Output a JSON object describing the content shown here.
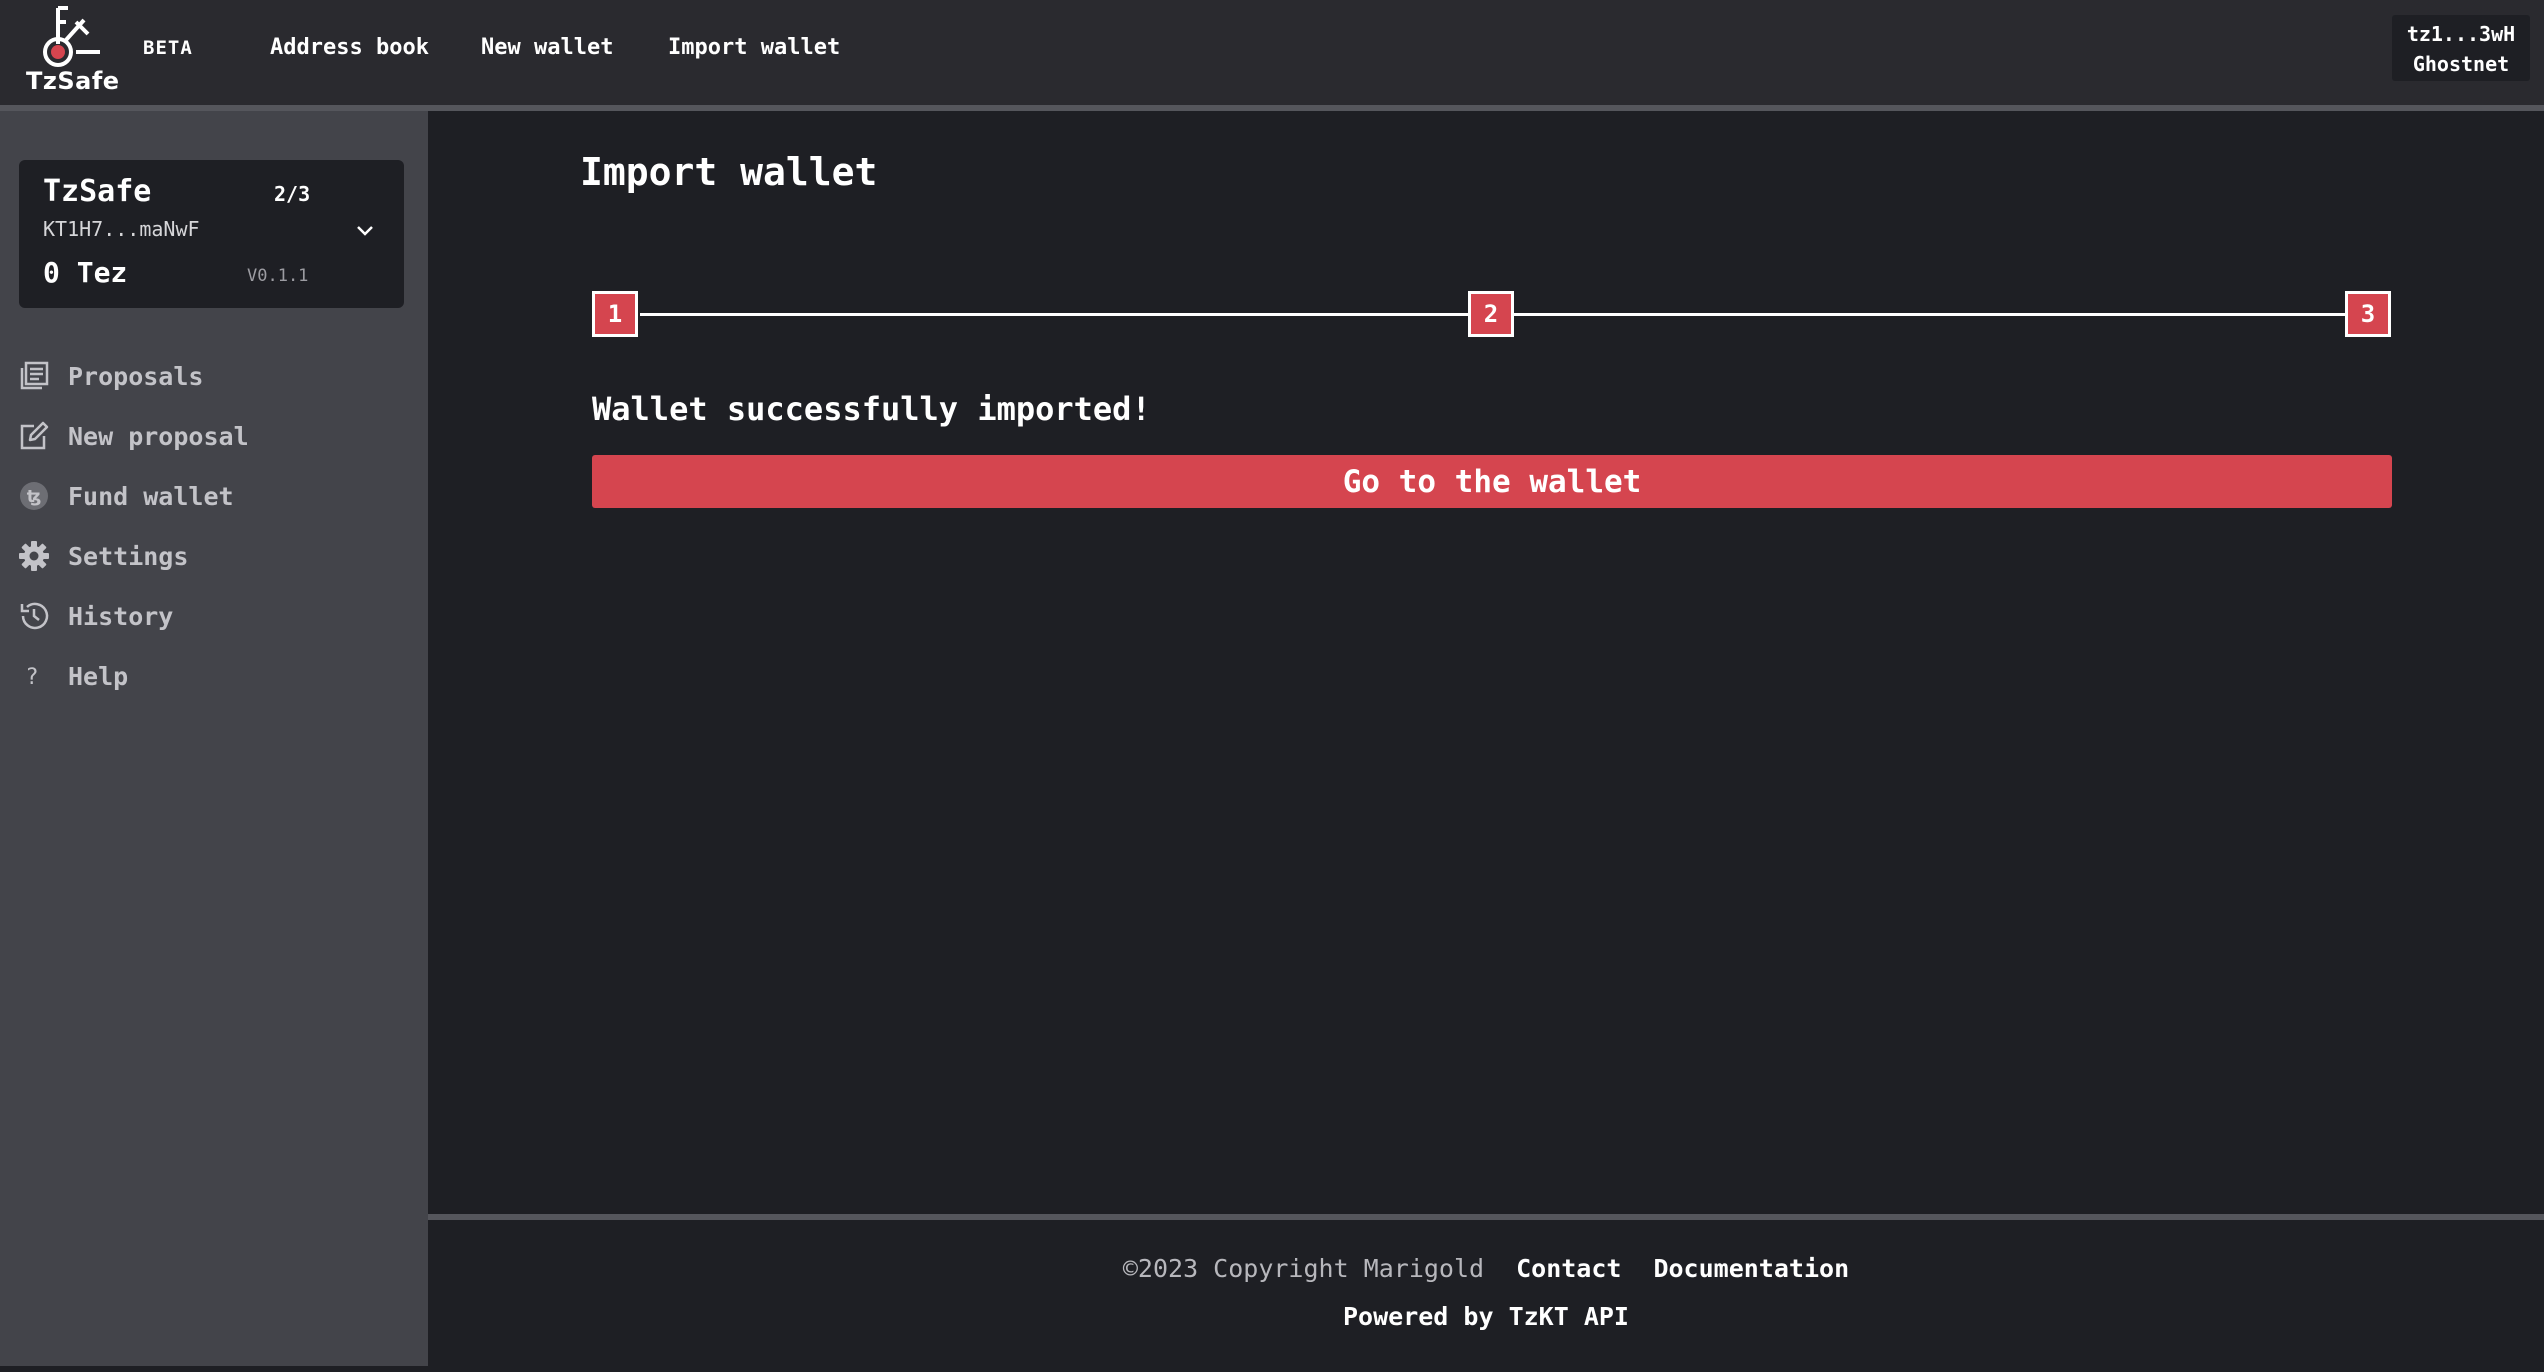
{
  "header": {
    "logo_text": "TzSafe",
    "beta_label": "BETA",
    "nav": [
      {
        "label": "Address book"
      },
      {
        "label": "New wallet"
      },
      {
        "label": "Import wallet"
      }
    ],
    "account": {
      "address": "tz1...3wH",
      "network": "Ghostnet"
    }
  },
  "sidebar": {
    "wallet": {
      "name": "TzSafe",
      "threshold": "2/3",
      "address": "KT1H7...maNwF",
      "balance": "0 Tez",
      "version": "V0.1.1"
    },
    "items": [
      {
        "label": "Proposals",
        "icon": "proposals-icon"
      },
      {
        "label": "New proposal",
        "icon": "edit-icon"
      },
      {
        "label": "Fund wallet",
        "icon": "tezos-coin-icon"
      },
      {
        "label": "Settings",
        "icon": "gear-icon"
      },
      {
        "label": "History",
        "icon": "history-icon"
      },
      {
        "label": "Help",
        "icon": "question-icon"
      }
    ]
  },
  "main": {
    "title": "Import wallet",
    "steps": [
      "1",
      "2",
      "3"
    ],
    "success_message": "Wallet successfully imported!",
    "go_button_label": "Go to the wallet"
  },
  "footer": {
    "copyright": "©2023 Copyright Marigold",
    "contact": "Contact",
    "documentation": "Documentation",
    "powered_by": "Powered by TzKT API"
  },
  "colors": {
    "accent": "#d5454f",
    "background": "#1e1f24",
    "sidebar": "#43444a",
    "topbar": "#2a2a2f"
  }
}
